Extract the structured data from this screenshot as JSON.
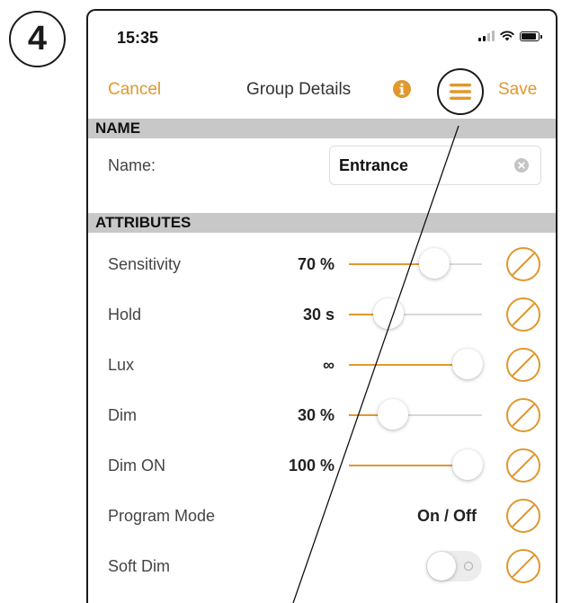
{
  "step": "4",
  "status_bar": {
    "time": "15:35"
  },
  "nav": {
    "cancel": "Cancel",
    "title": "Group Details",
    "save": "Save"
  },
  "name_section": {
    "header": "NAME",
    "label": "Name:",
    "value": "Entrance"
  },
  "attributes": {
    "header": "ATTRIBUTES",
    "rows": [
      {
        "label": "Sensitivity",
        "value": "70 %",
        "slider_level": 0.64
      },
      {
        "label": "Hold",
        "value": "30 s",
        "slider_level": 0.3
      },
      {
        "label": "Lux",
        "value": "∞",
        "slider_level": 0.89
      },
      {
        "label": "Dim",
        "value": "30 %",
        "slider_level": 0.33
      },
      {
        "label": "Dim ON",
        "value": "100 %",
        "slider_level": 0.89
      },
      {
        "label": "Program Mode",
        "value": "On / Off"
      },
      {
        "label": "Soft Dim",
        "toggle_on": false
      }
    ]
  },
  "colors": {
    "accent": "#e0982e",
    "section_bg": "#c8c8c8",
    "text": "#444444"
  },
  "icons": {
    "info": "info-circle-icon",
    "menu": "hamburger-menu-icon",
    "clear": "clear-x-icon",
    "reset": "slashed-circle-icon"
  }
}
